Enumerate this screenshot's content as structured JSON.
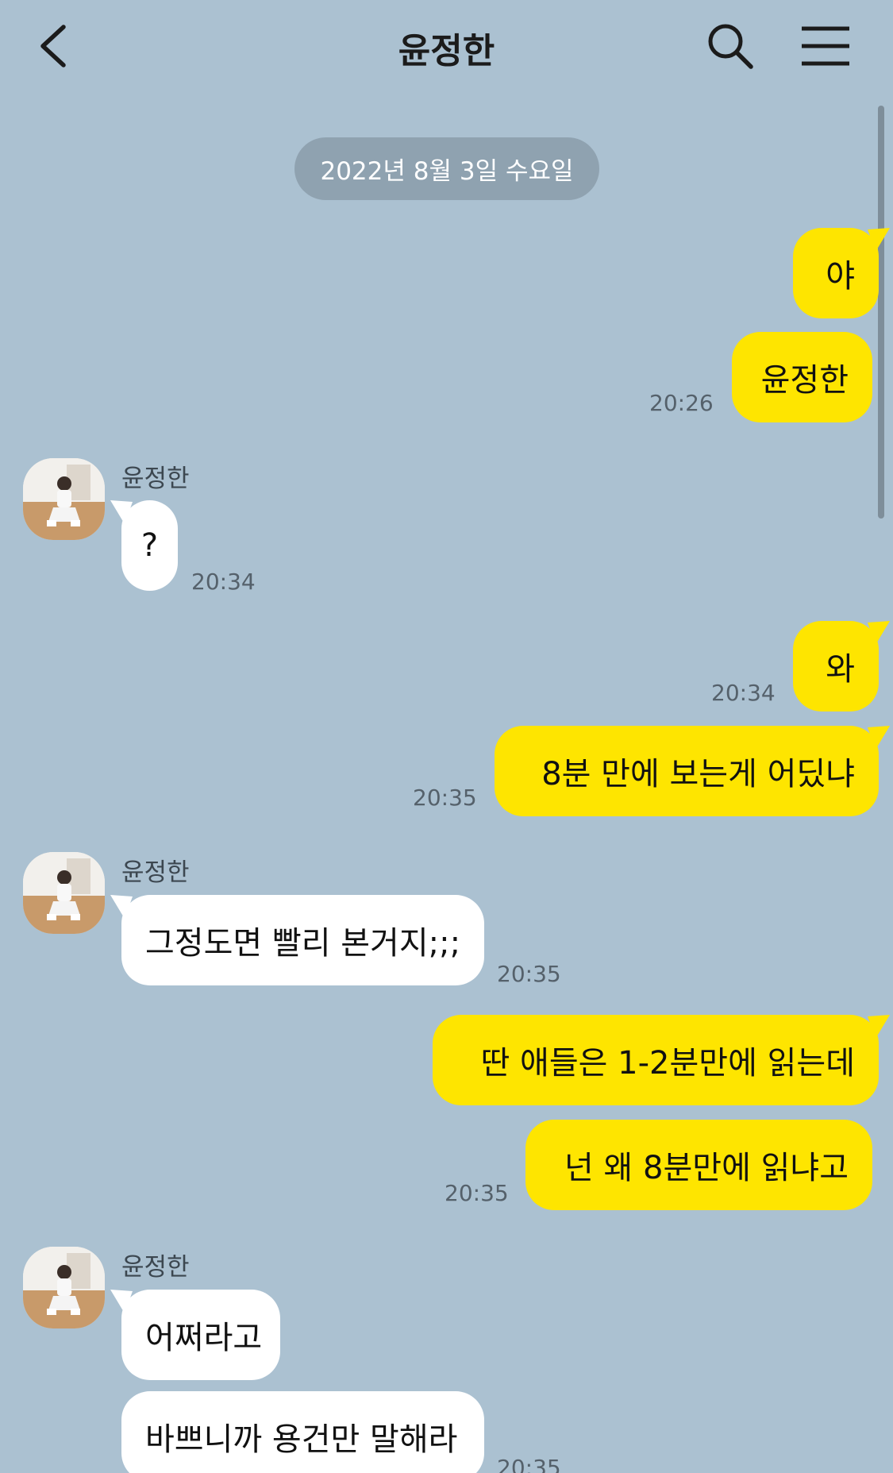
{
  "header": {
    "title": "윤정한",
    "back_icon": "chevron-left-icon",
    "search_icon": "search-icon",
    "menu_icon": "hamburger-menu-icon"
  },
  "colors": {
    "background": "#abc1d1",
    "my_bubble": "#fee500",
    "their_bubble": "#ffffff",
    "date_pill": "#8fa2b0"
  },
  "date_divider": "2022년 8월 3일 수요일",
  "messages": [
    {
      "from": "me",
      "text": "야"
    },
    {
      "from": "me",
      "text": "윤정한",
      "time": "20:26"
    },
    {
      "from": "them",
      "sender": "윤정한",
      "text": "?",
      "time": "20:34"
    },
    {
      "from": "me",
      "text": "와",
      "time": "20:34"
    },
    {
      "from": "me",
      "text": "8분 만에 보는게 어딨냐",
      "time": "20:35"
    },
    {
      "from": "them",
      "sender": "윤정한",
      "text": "그정도면 빨리 본거지;;;",
      "time": "20:35"
    },
    {
      "from": "me",
      "text": "딴 애들은 1-2분만에 읽는데"
    },
    {
      "from": "me",
      "text": "넌 왜 8분만에 읽냐고",
      "time": "20:35"
    },
    {
      "from": "them",
      "sender": "윤정한",
      "text": "어쩌라고"
    },
    {
      "from": "them",
      "text": "바쁘니까 용건만 말해라",
      "time": "20:35"
    }
  ]
}
